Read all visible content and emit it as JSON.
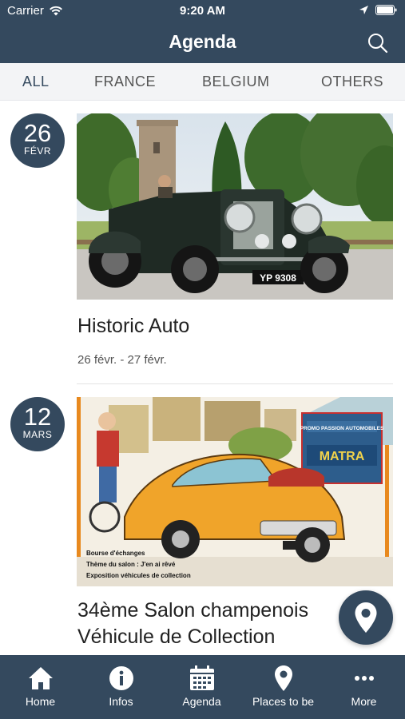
{
  "status": {
    "carrier": "Carrier",
    "time": "9:20 AM"
  },
  "header": {
    "title": "Agenda"
  },
  "tabs": [
    {
      "label": "ALL",
      "active": true
    },
    {
      "label": "FRANCE",
      "active": false
    },
    {
      "label": "BELGIUM",
      "active": false
    },
    {
      "label": "OTHERS",
      "active": false
    }
  ],
  "events": [
    {
      "day": "26",
      "month": "FÉVR",
      "title": "Historic Auto",
      "dates": "26 févr. - 27 févr.",
      "plate": "YP 9308"
    },
    {
      "day": "12",
      "month": "MARS",
      "title": "34ème Salon champenois Véhicule de Collection",
      "poster_sign_1": "PROMO PASSION AUTOMOBILES",
      "poster_sign_2": "MATRA",
      "poster_text_1": "Bourse d'échanges",
      "poster_text_2": "Thème du salon : J'en ai rêvé",
      "poster_text_3": "Exposition véhicules de collection"
    }
  ],
  "tabbar": [
    {
      "label": "Home",
      "icon": "home-icon"
    },
    {
      "label": "Infos",
      "icon": "info-icon"
    },
    {
      "label": "Agenda",
      "icon": "calendar-icon"
    },
    {
      "label": "Places to be",
      "icon": "map-pin-icon"
    },
    {
      "label": "More",
      "icon": "more-icon"
    }
  ],
  "colors": {
    "primary": "#34495e",
    "tab_bg": "#f3f4f6"
  }
}
